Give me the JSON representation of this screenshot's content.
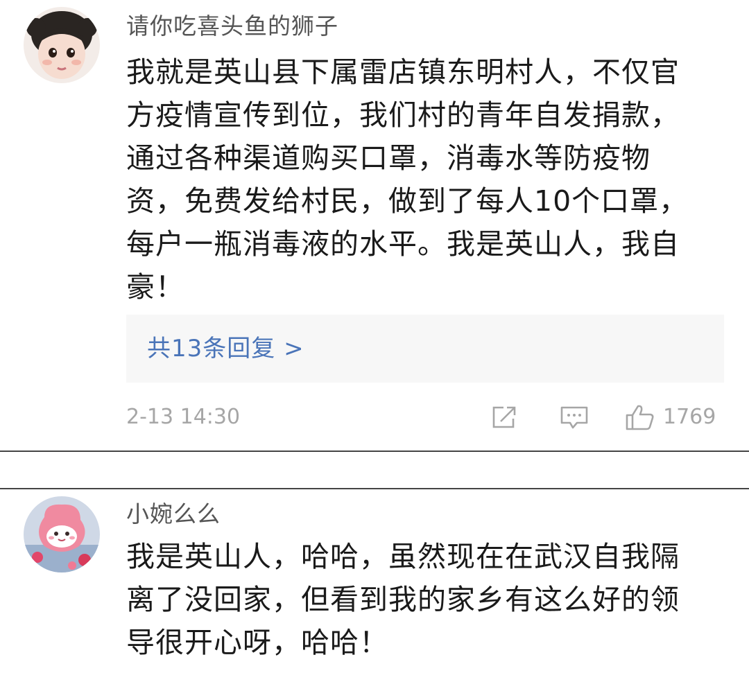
{
  "comments": [
    {
      "username": "请你吃喜头鱼的狮子",
      "text": "我就是英山县下属雷店镇东明村人，不仅官\n方疫情宣传到位，我们村的青年自发捐款，\n通过各种渠道购买口罩，消毒水等防疫物\n资，免费发给村民，做到了每人10个口罩，\n每户一瓶消毒液的水平。我是英山人，我自\n豪！",
      "replies_label": "共13条回复 >",
      "timestamp": "2-13 14:30",
      "like_count": "1769",
      "avatar_icon": "child-portrait-avatar"
    },
    {
      "username": "小婉么么",
      "text": "我是英山人，哈哈，虽然现在在武汉自我隔\n离了没回家，但看到我的家乡有这么好的领\n导很开心呀，哈哈！",
      "avatar_icon": "pink-mascot-avatar"
    }
  ],
  "icons": {
    "share": "share-icon",
    "comment": "comment-icon",
    "like": "thumbs-up-icon"
  },
  "colors": {
    "link": "#4a74b8",
    "meta": "#a6a6a6",
    "reply_bg": "#f7f7f7"
  }
}
